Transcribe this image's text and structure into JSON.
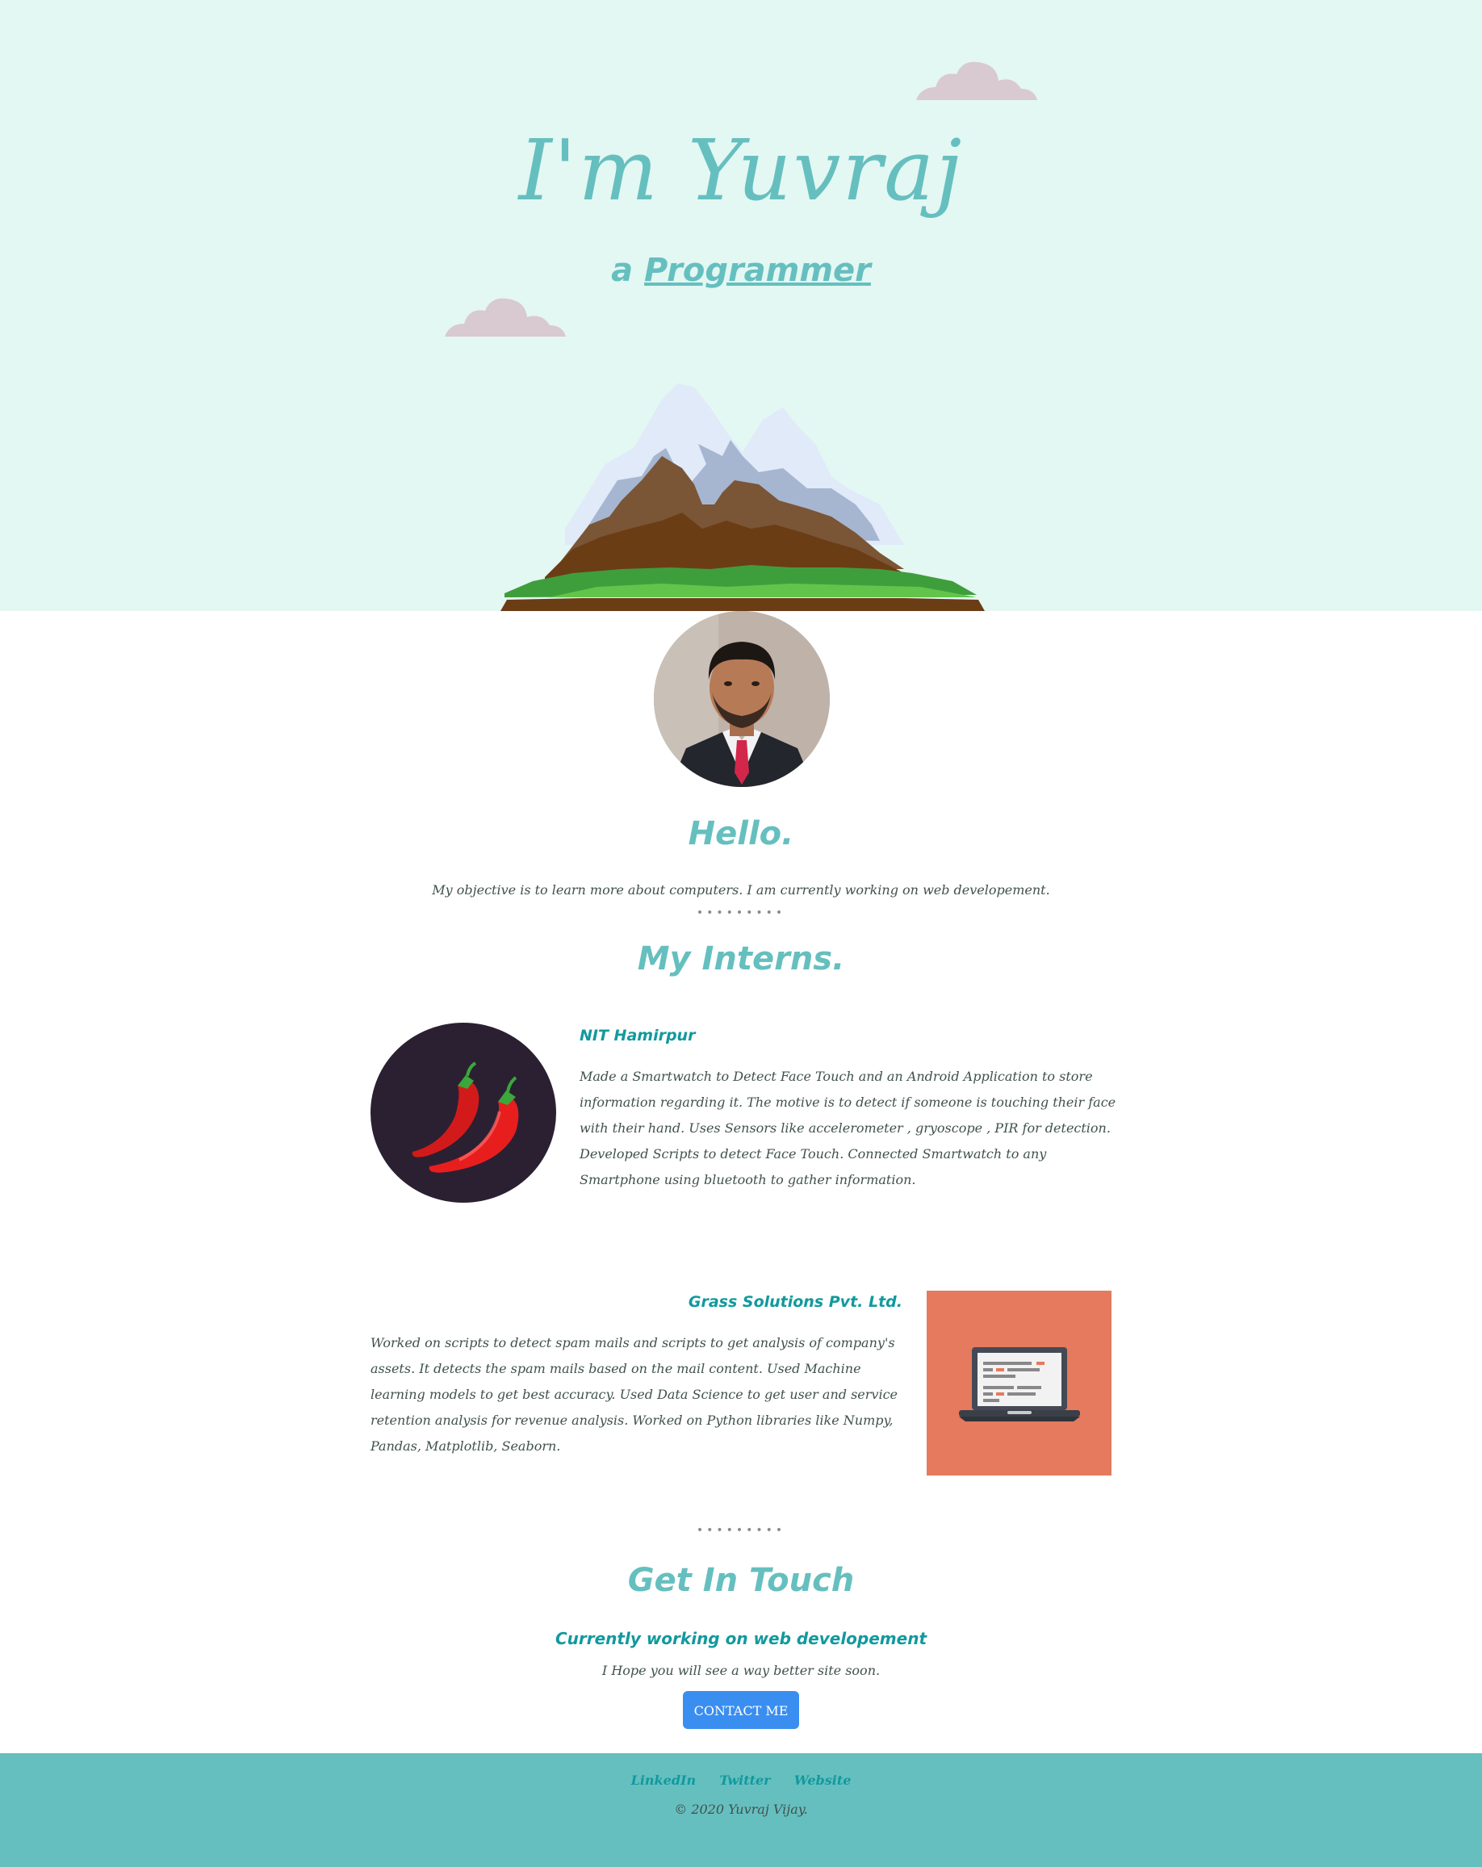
{
  "hero": {
    "title": "I'm Yuvraj",
    "subtitle_prefix": "a ",
    "subtitle_role": "Programmer"
  },
  "about": {
    "heading": "Hello.",
    "objective": "My objective is to learn more about computers. I am currently working on web developement."
  },
  "separator": "•••••••••",
  "interns": {
    "heading": "My Interns.",
    "items": [
      {
        "company": "NIT Hamirpur",
        "icon": "chili-peppers-icon",
        "description": "Made a Smartwatch to Detect Face Touch and an Android Application to store information regarding it. The motive is to detect if someone is touching their face with their hand. Uses Sensors like accelerometer , gryoscope , PIR for detection. Developed Scripts to detect Face Touch. Connected Smartwatch to any Smartphone using bluetooth to gather information."
      },
      {
        "company": "Grass Solutions Pvt. Ltd.",
        "icon": "laptop-icon",
        "description": "Worked on scripts to detect spam mails and scripts to get analysis of company's assets. It detects the spam mails based on the mail content. Used Machine learning models to get best accuracy. Used Data Science to get user and service retention analysis for revenue analysis. Worked on Python libraries like Numpy, Pandas, Matplotlib, Seaborn."
      }
    ]
  },
  "contact": {
    "heading": "Get In Touch",
    "subheading": "Currently working on web developement",
    "text": "I Hope you will see a way better site soon.",
    "button": "CONTACT ME"
  },
  "footer": {
    "links": [
      "LinkedIn",
      "Twitter",
      "Website"
    ],
    "copyright": "© 2020 Yuvraj Vijay."
  },
  "colors": {
    "hero_bg": "#e3f7f3",
    "accent": "#66bfbf",
    "heading_teal": "#11999e",
    "text": "#40514e",
    "button": "#3a8ef0",
    "laptop_bg": "#e57a5e",
    "chili_bg": "#2b2032"
  }
}
